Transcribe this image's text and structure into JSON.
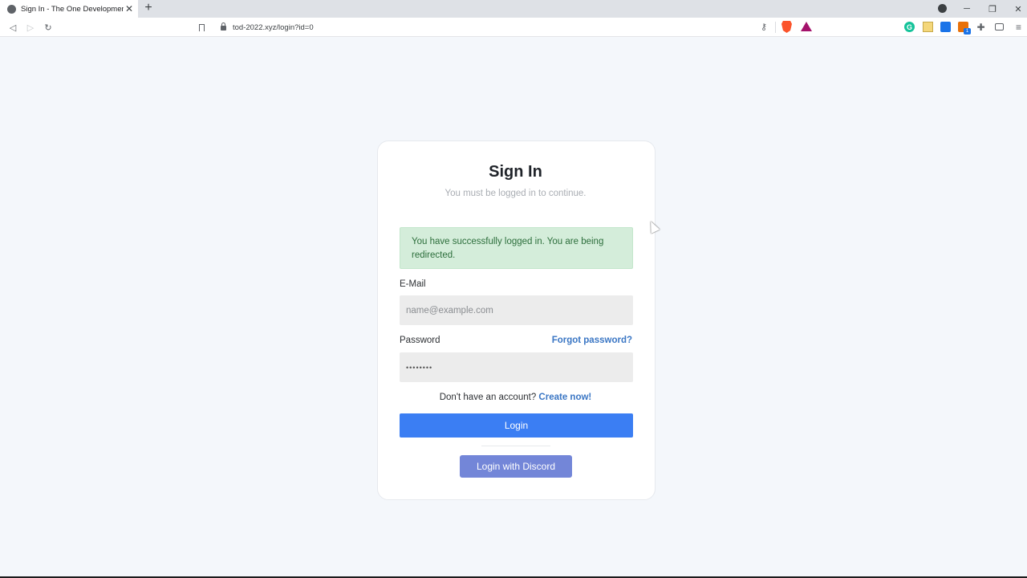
{
  "browser": {
    "tab_title": "Sign In - The One Development",
    "tab_close": "✕",
    "new_tab": "+",
    "url": "tod-2022.xyz/login?id=0",
    "window_controls": {
      "minimize": "─",
      "restore": "❐",
      "close": "✕"
    },
    "nav": {
      "back": "◁",
      "forward": "▷",
      "reload": "↻"
    }
  },
  "page": {
    "title": "Sign In",
    "subtitle": "You must be logged in to continue.",
    "alert": "You have successfully logged in. You are being redirected.",
    "email_label": "E-Mail",
    "email_placeholder": "name@example.com",
    "password_label": "Password",
    "password_value": "••••••••",
    "forgot_link": "Forgot password?",
    "signup_text": "Don't have an account?",
    "signup_link": "Create now!",
    "login_button": "Login",
    "discord_button": "Login with Discord"
  },
  "colors": {
    "primary": "#3b7ef3",
    "discord": "#7386d8",
    "link": "#3a76c4",
    "alert_bg": "#d4edda",
    "alert_text": "#2c6e3b",
    "page_bg": "#f4f7fb"
  },
  "icons": [
    "globe-icon",
    "close-icon",
    "plus-icon",
    "back-icon",
    "forward-icon",
    "reload-icon",
    "bookmark-icon",
    "lock-icon",
    "key-icon",
    "brave-shield-icon",
    "bat-rewards-icon",
    "grammarly-icon",
    "notes-icon",
    "tag-icon",
    "metamask-icon",
    "puzzle-icon",
    "wallet-icon",
    "menu-icon"
  ]
}
